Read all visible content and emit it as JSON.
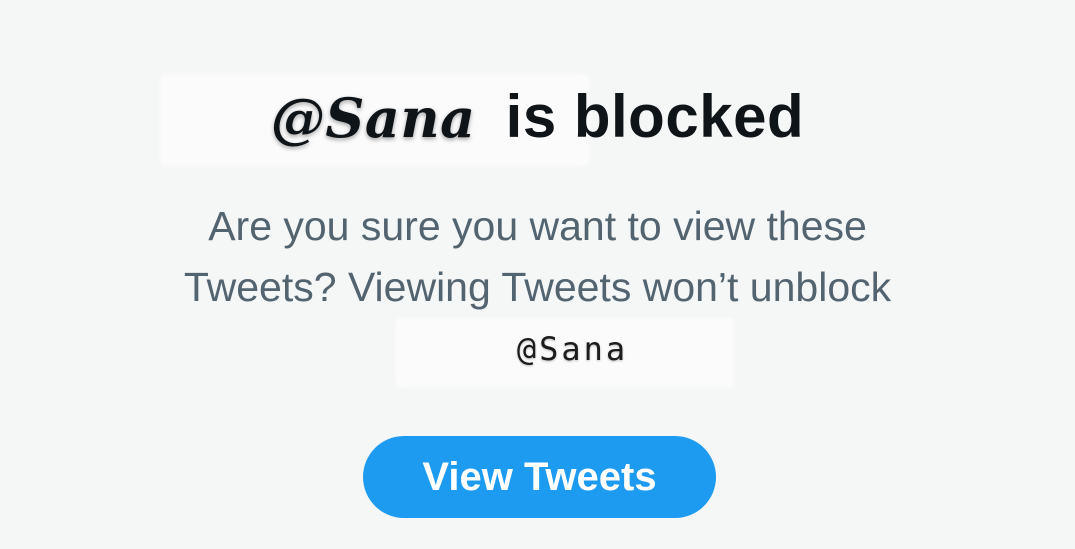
{
  "dialog": {
    "blocked_handle": "@Sana",
    "blocked_suffix": "is blocked",
    "message_line1": "Are you sure you want to view these",
    "message_line2": "Tweets? Viewing Tweets won’t unblock",
    "message_handle": "@Sana",
    "button_label": "View Tweets"
  },
  "colors": {
    "background": "#f5f6f6",
    "title_text": "#0f1419",
    "body_text": "#536471",
    "button_bg": "#1d9bf0",
    "button_text": "#ffffff"
  }
}
